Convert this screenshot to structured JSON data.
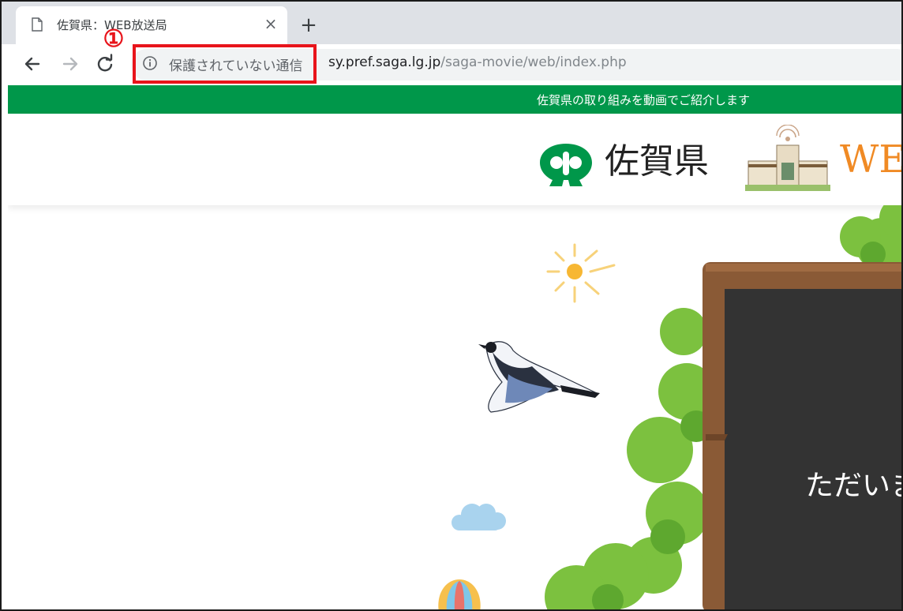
{
  "browser": {
    "tab": {
      "title": "佐賀県：WEB放送局",
      "close_glyph": "×"
    },
    "new_tab_glyph": "+",
    "toolbar": {
      "security_label": "保護されていない通信",
      "url_host": "sy.pref.saga.lg.jp",
      "url_path": "/saga-movie/web/index.php"
    }
  },
  "annotation": {
    "number": "①",
    "color": "#e8141b"
  },
  "site": {
    "banner_text": "佐賀県の取り組みを動画でご紹介します",
    "banner_color": "#00974a",
    "pref_name": "佐賀県",
    "brand_text": "WEB",
    "board_text": "ただいま"
  },
  "icons": [
    "page-icon",
    "close-icon",
    "plus-icon",
    "back-arrow-icon",
    "forward-arrow-icon",
    "reload-icon",
    "info-icon",
    "saga-logo-icon",
    "building-icon"
  ]
}
